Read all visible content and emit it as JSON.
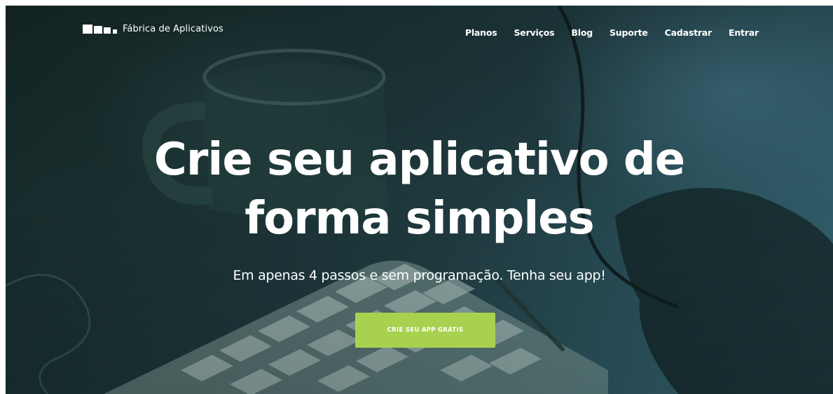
{
  "header": {
    "brand_name": "Fábrica de Aplicativos",
    "nav": [
      {
        "label": "Planos"
      },
      {
        "label": "Serviços"
      },
      {
        "label": "Blog"
      },
      {
        "label": "Suporte"
      },
      {
        "label": "Cadastrar"
      },
      {
        "label": "Entrar"
      }
    ]
  },
  "hero": {
    "headline_line1": "Crie seu aplicativo de",
    "headline_line2": "forma simples",
    "subtitle": "Em apenas 4 passos e sem programação. Tenha seu app!",
    "cta_label": "CRIE SEU APP GRÁTIS"
  },
  "colors": {
    "cta_background": "#a8d14f",
    "text": "#ffffff",
    "hero_overlay": "#1f3a3f"
  },
  "icons": {
    "logo": "three-squares-logo-icon"
  }
}
